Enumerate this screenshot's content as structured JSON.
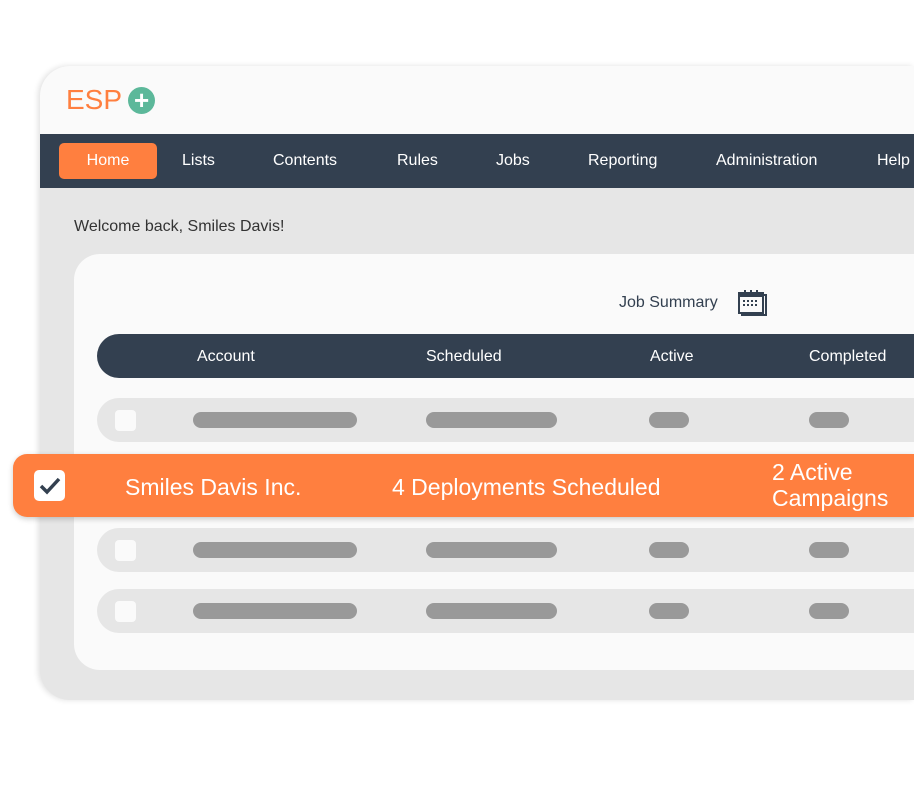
{
  "app": {
    "logo": "ESP",
    "logo_icon": "plus-circle-icon"
  },
  "nav": {
    "items": [
      {
        "label": "Home",
        "active": true
      },
      {
        "label": "Lists"
      },
      {
        "label": "Contents"
      },
      {
        "label": "Rules"
      },
      {
        "label": "Jobs"
      },
      {
        "label": "Reporting"
      },
      {
        "label": "Administration"
      },
      {
        "label": "Help"
      }
    ]
  },
  "welcome": "Welcome back, Smiles Davis!",
  "summary": {
    "title": "Job Summary",
    "icon": "calendar-icon",
    "columns": [
      "Account",
      "Scheduled",
      "Active",
      "Completed"
    ]
  },
  "selected_row": {
    "account": "Smiles Davis Inc.",
    "scheduled": "4 Deployments Scheduled",
    "active": "2 Active Campaigns",
    "checked": true
  },
  "colors": {
    "accent": "#ff7f3f",
    "nav": "#334050",
    "logo_plus": "#5cb89a"
  }
}
